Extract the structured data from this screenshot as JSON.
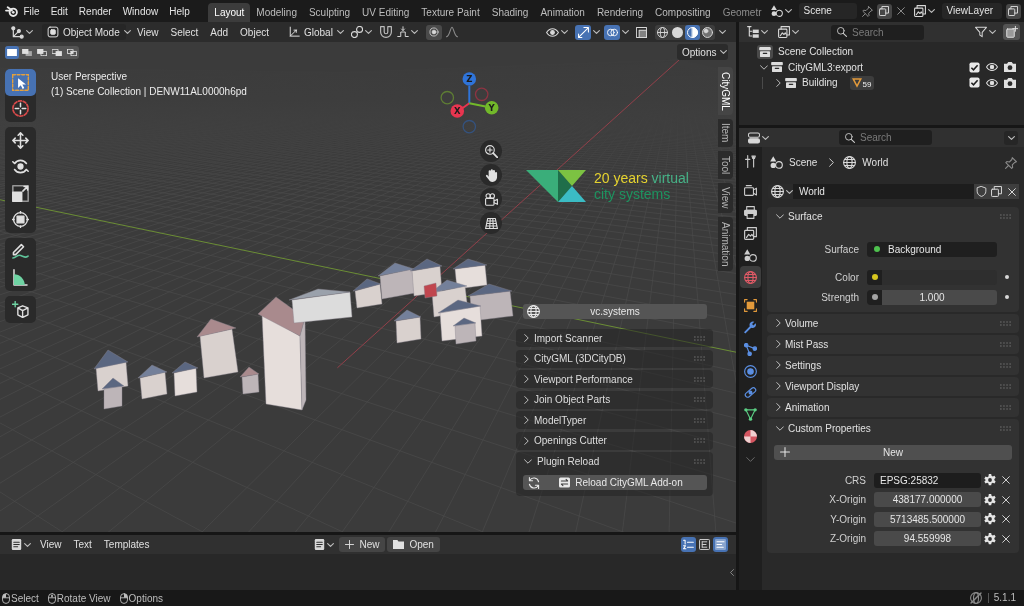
{
  "topbar": {
    "menus": [
      "File",
      "Edit",
      "Render",
      "Window",
      "Help"
    ],
    "workspaces": [
      {
        "label": "Layout",
        "selected": true
      },
      {
        "label": "Modeling",
        "selected": false
      },
      {
        "label": "Sculpting",
        "selected": false
      },
      {
        "label": "UV Editing",
        "selected": false
      },
      {
        "label": "Texture Paint",
        "selected": false
      },
      {
        "label": "Shading",
        "selected": false
      },
      {
        "label": "Animation",
        "selected": false
      },
      {
        "label": "Rendering",
        "selected": false
      },
      {
        "label": "Compositing",
        "selected": false
      },
      {
        "label": "Geometr",
        "selected": false
      }
    ],
    "scene": "Scene",
    "view_layer": "ViewLayer"
  },
  "viewport": {
    "header": {
      "mode": "Object Mode",
      "menus": [
        "View",
        "Select",
        "Add",
        "Object"
      ],
      "orientation": "Global",
      "toggles": [
        {
          "kind": "gizmos",
          "on": true
        },
        {
          "kind": "overlays",
          "on": true
        },
        {
          "kind": "xray",
          "on": false
        }
      ],
      "shading": [
        {
          "kind": "wireframe",
          "selected": false
        },
        {
          "kind": "solid",
          "selected": false
        },
        {
          "kind": "material",
          "selected": true
        },
        {
          "kind": "rendered",
          "selected": false
        }
      ]
    },
    "select_modes": [
      {
        "kind": "set",
        "selected": true
      },
      {
        "kind": "extend",
        "selected": false
      },
      {
        "kind": "subtract",
        "selected": false
      },
      {
        "kind": "invert",
        "selected": false
      },
      {
        "kind": "intersect",
        "selected": false
      }
    ],
    "options": "Options",
    "info": [
      "User Perspective",
      "(1) Scene Collection | DENW11AL0000h6pd"
    ],
    "tool_groups": [
      {
        "tools": [
          {
            "kind": "select",
            "selected": true
          },
          {
            "kind": "cursor",
            "selected": false
          }
        ]
      },
      {
        "tools": [
          {
            "kind": "move",
            "selected": false
          },
          {
            "kind": "rotate",
            "selected": false
          },
          {
            "kind": "scale",
            "selected": false
          },
          {
            "kind": "transform",
            "selected": false
          }
        ]
      },
      {
        "tools": [
          {
            "kind": "annotate",
            "selected": false
          },
          {
            "kind": "measure",
            "selected": false
          }
        ]
      },
      {
        "tools": [
          {
            "kind": "add_cube",
            "selected": false
          }
        ]
      }
    ],
    "gizmo_axes": [
      {
        "label": "X",
        "color": "#e8354f"
      },
      {
        "label": "Y",
        "color": "#72b82a"
      },
      {
        "label": "Z",
        "color": "#2f74d9"
      }
    ],
    "logo": {
      "accent": "20 years",
      "rest": "virtual",
      "subline": "city systems"
    },
    "sidebar_tabs": [
      {
        "label": "CityGML",
        "selected": true
      },
      {
        "label": "Item",
        "selected": false
      },
      {
        "label": "Tool",
        "selected": false
      },
      {
        "label": "View",
        "selected": false
      },
      {
        "label": "Animation",
        "selected": false
      }
    ],
    "sidebar": {
      "link_button": "vc.systems",
      "panels": [
        {
          "title": "Import Scanner",
          "expanded": false
        },
        {
          "title": "CityGML (3DCityDB)",
          "expanded": false
        },
        {
          "title": "Viewport Performance",
          "expanded": false
        },
        {
          "title": "Join Object Parts",
          "expanded": false
        },
        {
          "title": "ModelTyper",
          "expanded": false
        },
        {
          "title": "Openings Cutter",
          "expanded": false
        },
        {
          "title": "Plugin Reload",
          "expanded": true,
          "button": "Reload CityGML Add-on"
        }
      ]
    }
  },
  "outliner": {
    "search": {
      "placeholder": "Search"
    },
    "tree": [
      {
        "label": "Scene Collection",
        "children": [
          {
            "label": "CityGML3:export",
            "expanded": true,
            "checked": true,
            "visible": true,
            "renderable": true,
            "children": [
              {
                "label": "Building",
                "expanded": false,
                "checked": true,
                "visible": true,
                "renderable": true,
                "count": "59"
              }
            ]
          }
        ]
      }
    ]
  },
  "properties": {
    "search": {
      "placeholder": "Search"
    },
    "tab_groups": [
      {
        "tabs": [
          {
            "kind": "tool",
            "selected": false
          }
        ]
      },
      {
        "tabs": [
          {
            "kind": "render",
            "selected": false
          },
          {
            "kind": "output",
            "selected": false
          },
          {
            "kind": "view_layer",
            "selected": false
          },
          {
            "kind": "scene",
            "selected": false
          },
          {
            "kind": "world",
            "selected": true
          }
        ]
      },
      {
        "tabs": [
          {
            "kind": "object",
            "selected": false
          },
          {
            "kind": "modifiers",
            "selected": false
          },
          {
            "kind": "particles",
            "selected": false
          },
          {
            "kind": "physics",
            "selected": false
          },
          {
            "kind": "constraints",
            "selected": false
          },
          {
            "kind": "data",
            "selected": false
          },
          {
            "kind": "material",
            "selected": false
          }
        ]
      }
    ],
    "breadcrumb": [
      {
        "kind": "scene",
        "label": "Scene"
      },
      {
        "kind": "world",
        "label": "World"
      }
    ],
    "datablock": "World",
    "panels": [
      {
        "title": "Surface",
        "expanded": true,
        "rows": [
          {
            "kind": "shader",
            "label": "Surface",
            "value": "Background",
            "color": "#4fc24f"
          },
          {
            "kind": "swatch",
            "label": "Color",
            "color": "#d7c61f"
          },
          {
            "kind": "slider",
            "label": "Strength",
            "value": "1.000",
            "color": "#a3a3a3"
          }
        ]
      },
      {
        "title": "Volume",
        "expanded": false
      },
      {
        "title": "Mist Pass",
        "expanded": false
      },
      {
        "title": "Settings",
        "expanded": false
      },
      {
        "title": "Viewport Display",
        "expanded": false
      },
      {
        "title": "Animation",
        "expanded": false
      },
      {
        "title": "Custom Properties",
        "expanded": true,
        "button": "New",
        "rows": [
          {
            "kind": "text",
            "label": "CRS",
            "value": "EPSG:25832"
          },
          {
            "kind": "number",
            "label": "X-Origin",
            "value": "438177.000000"
          },
          {
            "kind": "number",
            "label": "Y-Origin",
            "value": "5713485.500000"
          },
          {
            "kind": "number",
            "label": "Z-Origin",
            "value": "94.559998"
          }
        ]
      }
    ]
  },
  "text_editor": {
    "menus": [
      "View",
      "Text",
      "Templates"
    ],
    "new_button": "New",
    "open_button": "Open",
    "toggles": [
      {
        "kind": "numbers",
        "on": true
      },
      {
        "kind": "wrap",
        "on": false
      },
      {
        "kind": "syntax",
        "on": true
      }
    ]
  },
  "status_bar": {
    "hints": [
      {
        "kind": "left",
        "label": "Select"
      },
      {
        "kind": "middle",
        "label": "Rotate View"
      },
      {
        "kind": "right",
        "label": "Options"
      }
    ],
    "version": "5.1.1"
  }
}
